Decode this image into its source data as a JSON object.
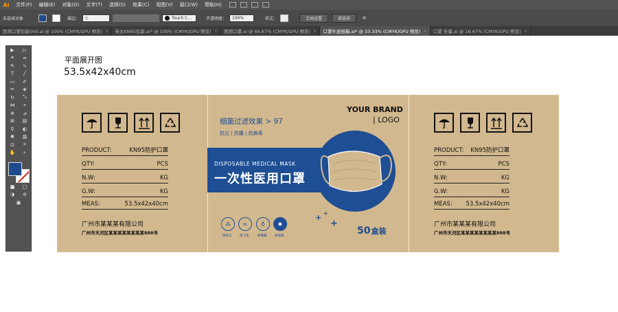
{
  "app": {
    "logo": "Ai"
  },
  "menu": [
    "文件(F)",
    "编辑(E)",
    "对象(O)",
    "文字(T)",
    "选择(S)",
    "效果(C)",
    "视图(V)",
    "窗口(W)",
    "帮助(H)"
  ],
  "control": {
    "no_selection": "未选择对象",
    "stroke_label": "描边：",
    "font_value": "Touch C...",
    "opacity_label": "不透明度：",
    "opacity_value": "100%",
    "style_label": "样式：",
    "doc_settings": "文档设置",
    "preferences": "首选项"
  },
  "tabs": [
    {
      "label": "医用口罩包装000.ai @ 100% (CMYK/GPU 预览)"
    },
    {
      "label": "英文KN95包装.ai* @ 100% (CMYK/GPU 预览)"
    },
    {
      "label": "医用口罩.ai @ 66.67% (CMYK/GPU 预览)"
    },
    {
      "label": "口罩牛皮纸箱.ai* @ 33.33% (CMYK/GPU 预览)"
    },
    {
      "label": "口罩 矢量.ai @ 16.67% (CMYK/GPU 预览)"
    }
  ],
  "canvas": {
    "title": "平面展开图",
    "size": "53.5x42x40cm"
  },
  "panel": {
    "rows": [
      {
        "label": "PRODUCT:",
        "value": "KN95防护口罩"
      },
      {
        "label": "QTY:",
        "value": "PCS"
      },
      {
        "label": "N.W:",
        "value": "KG"
      },
      {
        "label": "G.W:",
        "value": "KG"
      },
      {
        "label": "MEAS:",
        "value": "53.5x42x40cm"
      }
    ],
    "company": "广州市某某某有限公司",
    "address": "广州市天河区某某某某某某某某888号"
  },
  "front": {
    "brand": "YOUR BRAND",
    "logo": "| LOGO",
    "filter": "细菌过滤效果 > 97",
    "props": "抗尘 | 抗霾 | 抗病毒",
    "disposable": "DISPOSABLE MEDICAL MASK",
    "title_cn": "一次性医用口罩",
    "count": "50",
    "count_unit": "盒装",
    "features": [
      "防粉尘",
      "防飞沫",
      "防雾霾",
      "防病毒"
    ]
  },
  "colors": {
    "kraft": "#d2b88e",
    "brand_blue": "#1e4e93",
    "ui_dark": "#535353"
  }
}
